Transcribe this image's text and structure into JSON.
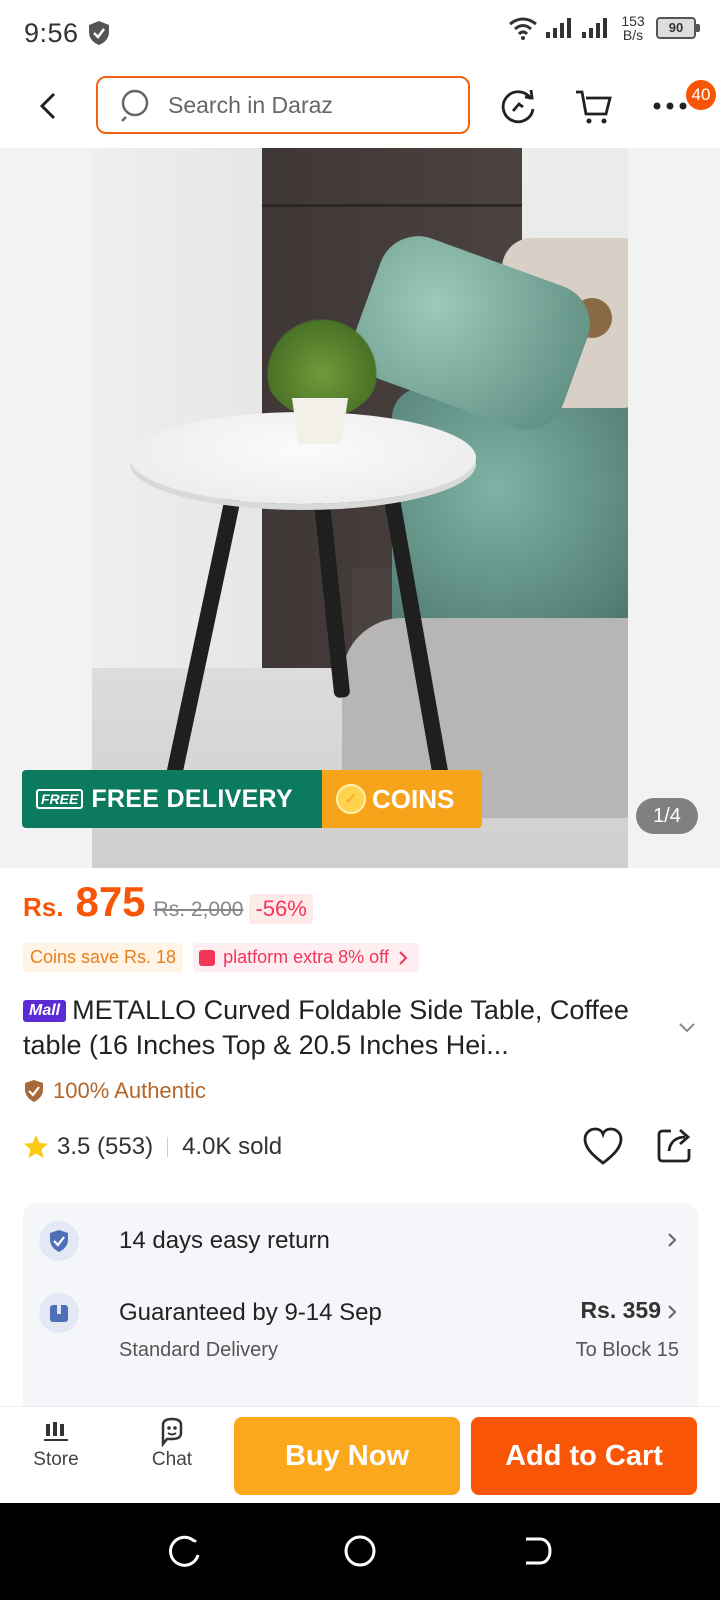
{
  "status_bar": {
    "time": "9:56",
    "net_speed_value": "153",
    "net_speed_unit": "B/s",
    "battery": "90"
  },
  "header": {
    "search_placeholder": "Search in Daraz",
    "cart_badge": "40"
  },
  "gallery": {
    "delivery_label": "FREE DELIVERY",
    "free_tag": "FREE",
    "coins_label": "COINS",
    "page_indicator": "1/4"
  },
  "price": {
    "currency": "Rs.",
    "current": "875",
    "original": "Rs. 2,000",
    "discount": "-56%"
  },
  "promos": {
    "coins_save": "Coins save Rs. 18",
    "platform_extra": "platform extra 8% off"
  },
  "product": {
    "mall_badge": "Mall",
    "title": "METALLO Curved Foldable Side Table, Coffee table (16 Inches Top & 20.5 Inches Hei...",
    "authentic": "100% Authentic",
    "rating": "3.5 (553)",
    "sold": "4.0K sold"
  },
  "services": {
    "returns": "14 days easy return",
    "delivery_title": "Guaranteed by 9-14 Sep",
    "delivery_sub": "Standard Delivery",
    "delivery_price": "Rs. 359",
    "delivery_location": "To Block 15"
  },
  "bottom_bar": {
    "store_label": "Store",
    "chat_label": "Chat",
    "buy_now": "Buy Now",
    "add_to_cart": "Add to Cart"
  },
  "colors": {
    "brand_orange": "#f85606",
    "buy_now_yellow": "#fba81d",
    "delivery_green": "#0b7a5f",
    "mall_purple": "#5b2bd6"
  }
}
